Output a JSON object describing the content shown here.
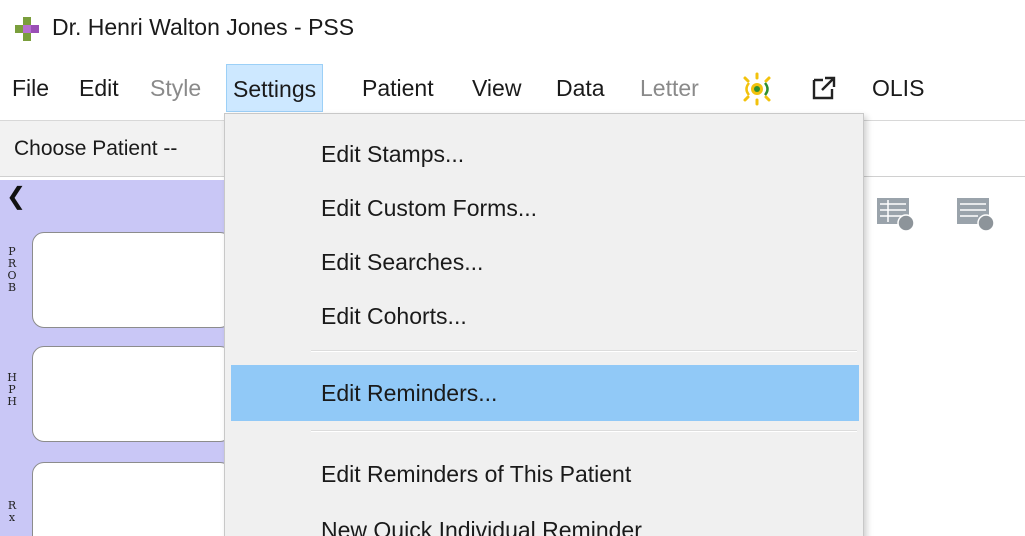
{
  "window": {
    "title": "Dr. Henri Walton Jones - PSS",
    "logo_icon": "pss-logo-icon"
  },
  "menubar": {
    "items": [
      {
        "label": "File",
        "disabled": false
      },
      {
        "label": "Edit",
        "disabled": false
      },
      {
        "label": "Style",
        "disabled": true
      },
      {
        "label": "Settings",
        "disabled": false,
        "open": true
      },
      {
        "label": "Patient",
        "disabled": false
      },
      {
        "label": "View",
        "disabled": false
      },
      {
        "label": "Data",
        "disabled": false
      },
      {
        "label": "Letter",
        "disabled": true
      },
      {
        "label": "OLIS",
        "disabled": false
      }
    ],
    "icons": [
      "signal-broadcast-icon",
      "popout-window-icon"
    ]
  },
  "patient_bar": {
    "choose_label": "Choose Patient --"
  },
  "side_panel": {
    "collapse_icon": "chevron-left-icon",
    "sections": [
      {
        "label": "PROB"
      },
      {
        "label": "HPH"
      },
      {
        "label": "Rx"
      }
    ]
  },
  "settings_menu": {
    "items": [
      {
        "label": "Edit Stamps..."
      },
      {
        "label": "Edit Custom Forms..."
      },
      {
        "label": "Edit Searches..."
      },
      {
        "label": "Edit Cohorts..."
      },
      {
        "label": "Edit Reminders...",
        "highlighted": true
      },
      {
        "label": "Edit Reminders of This Patient"
      },
      {
        "label": "New Quick Individual Reminder"
      }
    ]
  },
  "toolbar_right": {
    "icons": [
      "document-grid-icon",
      "document-list-icon"
    ]
  },
  "colors": {
    "menu_highlight": "#91c9f7",
    "open_menu_bg": "#cde8ff",
    "side_panel_bg": "#c9c7f6",
    "dropdown_bg": "#f0f0f0",
    "signal_icon": "#f2c20c"
  }
}
